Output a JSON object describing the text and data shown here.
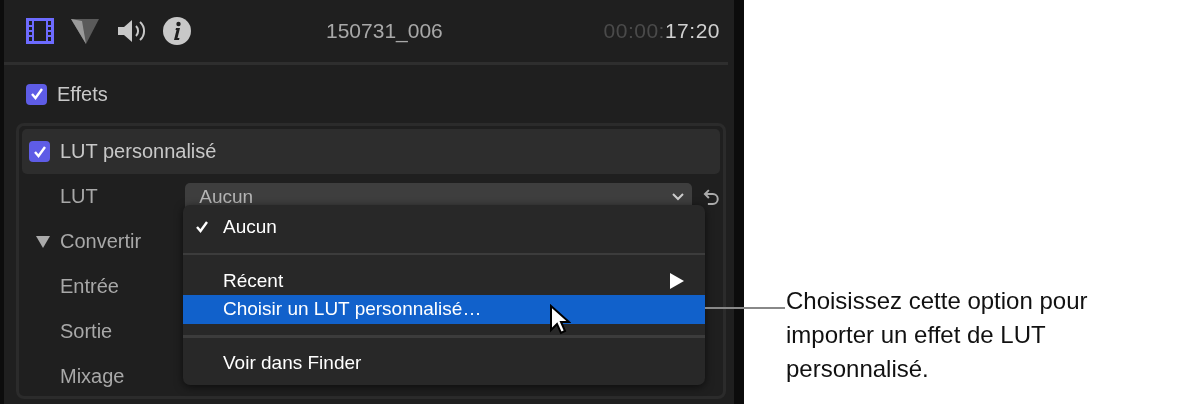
{
  "inspector_tabs": [
    {
      "kind": "video",
      "selected": true
    },
    {
      "kind": "color",
      "selected": false
    },
    {
      "kind": "audio",
      "selected": false
    },
    {
      "kind": "info",
      "selected": false
    }
  ],
  "clip_name": "150731_006",
  "timecode": {
    "dim": "00:00:",
    "value": "17:20"
  },
  "effects": {
    "label": "Effets",
    "checked": true
  },
  "effect": {
    "label": "LUT personnalisé",
    "checked": true,
    "parameters": [
      {
        "kind": "popup",
        "label": "LUT",
        "value": "Aucun"
      },
      {
        "kind": "group",
        "label": "Convertir",
        "expanded": true,
        "children": [
          {
            "label": "Entrée"
          },
          {
            "label": "Sortie"
          },
          {
            "label": "Mixage"
          }
        ]
      }
    ]
  },
  "menu": [
    {
      "kind": "item",
      "label": "Aucun",
      "checked": true,
      "selected": false,
      "submenu": false
    },
    {
      "kind": "separator"
    },
    {
      "kind": "item",
      "label": "Récent",
      "checked": false,
      "selected": false,
      "submenu": true
    },
    {
      "kind": "item",
      "label": "Choisir un LUT personnalisé…",
      "checked": false,
      "selected": true,
      "submenu": false
    },
    {
      "kind": "separator"
    },
    {
      "kind": "item",
      "label": "Voir dans Finder",
      "checked": false,
      "selected": false,
      "submenu": false
    }
  ],
  "callout": "Choisissez cette option pour importer un effet de LUT personnalisé."
}
